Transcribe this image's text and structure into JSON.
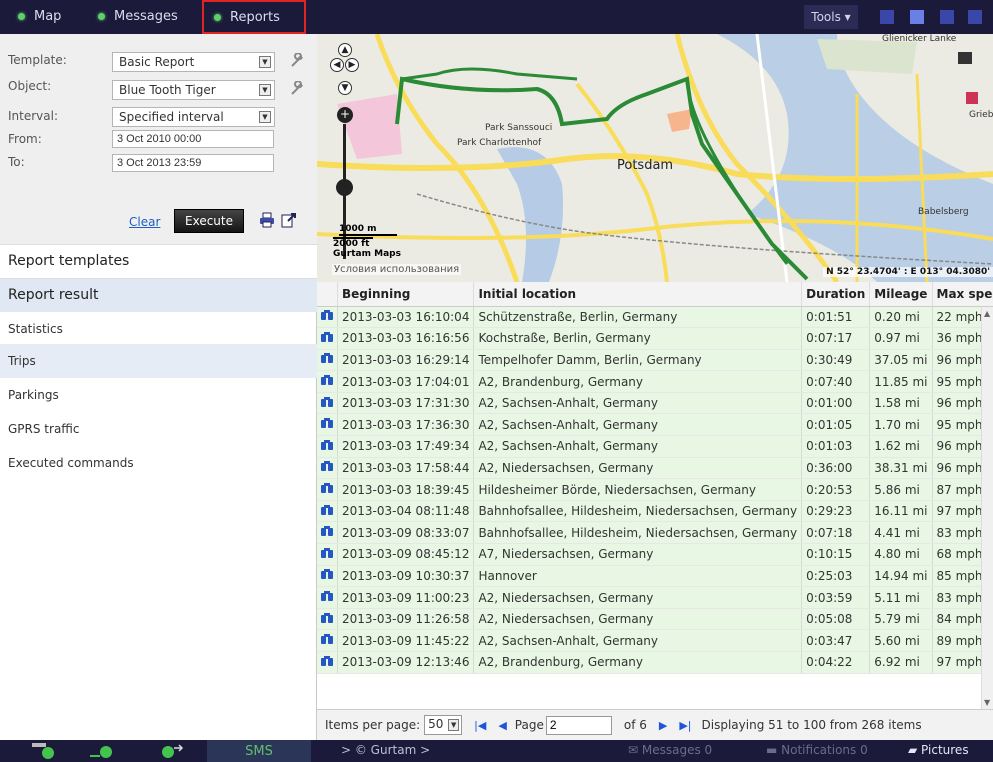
{
  "nav": {
    "tabs": [
      {
        "label": "Map"
      },
      {
        "label": "Messages"
      },
      {
        "label": "Reports"
      }
    ],
    "tools_label": "Tools ▾"
  },
  "params": {
    "template_label": "Template:",
    "template_value": "Basic Report",
    "object_label": "Object:",
    "object_value": "Blue Tooth Tiger",
    "interval_label": "Interval:",
    "interval_value": "Specified interval",
    "from_label": "From:",
    "from_value": "3 Oct 2010 00:00",
    "to_label": "To:",
    "to_value": "3 Oct 2013 23:59",
    "clear_label": "Clear",
    "execute_label": "Execute"
  },
  "sections": {
    "templates": "Report templates",
    "result": "Report result"
  },
  "result_items": [
    "Statistics",
    "Trips",
    "Parkings",
    "GPRS traffic",
    "Executed commands"
  ],
  "map": {
    "labels": {
      "potsdam": "Potsdam",
      "sanssouci": "Park Sanssouci",
      "charlottenhof": "Park Charlottenhof",
      "babelsberg": "Babelsberg",
      "glienicker": "Glienicker Lanke",
      "griebnitz": "Grieb"
    },
    "scale_m": "1000 m",
    "scale_ft": "2000 ft",
    "provider": "Gurtam Maps",
    "copyright": "Условия использования",
    "coords": "N 52° 23.4704' : E 013° 04.3080'"
  },
  "table": {
    "headers": [
      "Beginning",
      "Initial location",
      "Duration",
      "Mileage",
      "Max speed"
    ],
    "rows": [
      [
        "2013-03-03 16:10:04",
        "Schützenstraße, Berlin, Germany",
        "0:01:51",
        "0.20 mi",
        "22 mph"
      ],
      [
        "2013-03-03 16:16:56",
        "Kochstraße, Berlin, Germany",
        "0:07:17",
        "0.97 mi",
        "36 mph"
      ],
      [
        "2013-03-03 16:29:14",
        "Tempelhofer Damm, Berlin, Germany",
        "0:30:49",
        "37.05 mi",
        "96 mph"
      ],
      [
        "2013-03-03 17:04:01",
        "A2, Brandenburg, Germany",
        "0:07:40",
        "11.85 mi",
        "95 mph"
      ],
      [
        "2013-03-03 17:31:30",
        "A2, Sachsen-Anhalt, Germany",
        "0:01:00",
        "1.58 mi",
        "96 mph"
      ],
      [
        "2013-03-03 17:36:30",
        "A2, Sachsen-Anhalt, Germany",
        "0:01:05",
        "1.70 mi",
        "95 mph"
      ],
      [
        "2013-03-03 17:49:34",
        "A2, Sachsen-Anhalt, Germany",
        "0:01:03",
        "1.62 mi",
        "96 mph"
      ],
      [
        "2013-03-03 17:58:44",
        "A2, Niedersachsen, Germany",
        "0:36:00",
        "38.31 mi",
        "96 mph"
      ],
      [
        "2013-03-03 18:39:45",
        "Hildesheimer Börde, Niedersachsen, Germany",
        "0:20:53",
        "5.86 mi",
        "87 mph"
      ],
      [
        "2013-03-04 08:11:48",
        "Bahnhofsallee, Hildesheim, Niedersachsen, Germany",
        "0:29:23",
        "16.11 mi",
        "97 mph"
      ],
      [
        "2013-03-09 08:33:07",
        "Bahnhofsallee, Hildesheim, Niedersachsen, Germany",
        "0:07:18",
        "4.41 mi",
        "83 mph"
      ],
      [
        "2013-03-09 08:45:12",
        "A7, Niedersachsen, Germany",
        "0:10:15",
        "4.80 mi",
        "68 mph"
      ],
      [
        "2013-03-09 10:30:37",
        "Hannover",
        "0:25:03",
        "14.94 mi",
        "85 mph"
      ],
      [
        "2013-03-09 11:00:23",
        "A2, Niedersachsen, Germany",
        "0:03:59",
        "5.11 mi",
        "83 mph"
      ],
      [
        "2013-03-09 11:26:58",
        "A2, Niedersachsen, Germany",
        "0:05:08",
        "5.79 mi",
        "84 mph"
      ],
      [
        "2013-03-09 11:45:22",
        "A2, Sachsen-Anhalt, Germany",
        "0:03:47",
        "5.60 mi",
        "89 mph"
      ],
      [
        "2013-03-09 12:13:46",
        "A2, Brandenburg, Germany",
        "0:04:22",
        "6.92 mi",
        "97 mph"
      ]
    ]
  },
  "pager": {
    "items_per_page_label": "Items per page:",
    "items_per_page_value": "50",
    "page_label": "Page",
    "page_value": "2",
    "of_label": "of 6",
    "displaying": "Displaying 51 to 100 from 268 items"
  },
  "bottom": {
    "sms_label": "SMS",
    "gurtam_label": "> © Gurtam >",
    "messages_label": "Messages 0",
    "notifications_label": "Notifications 0",
    "pictures_label": "Pictures"
  },
  "colors": {
    "accent_green": "#5fd068",
    "row_bg": "#e8f7e4",
    "topbar_bg": "#1b1a3a",
    "highlight_border": "#e02424"
  }
}
